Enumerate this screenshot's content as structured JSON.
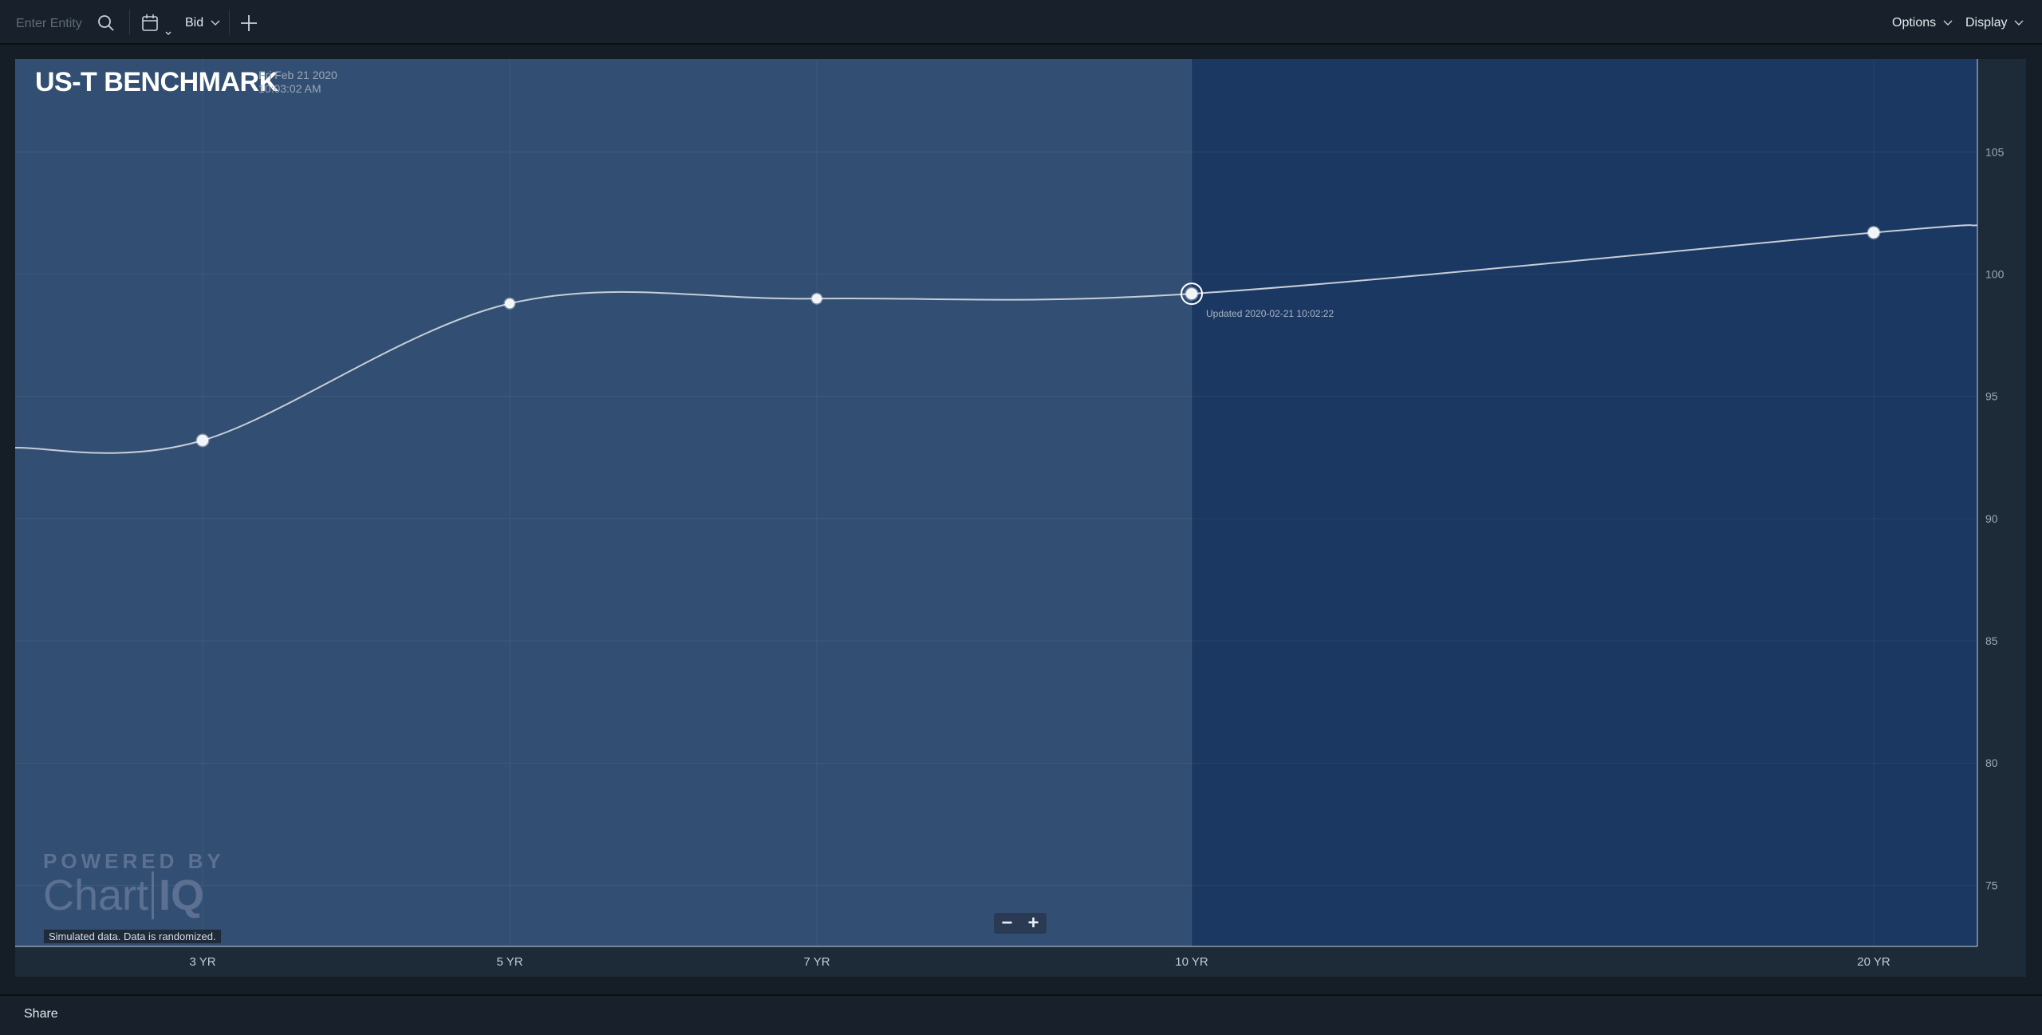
{
  "toolbar": {
    "entity_placeholder": "Enter Entity",
    "bid_label": "Bid",
    "options_label": "Options",
    "display_label": "Display"
  },
  "chart": {
    "title": "US-T BENCHMARK",
    "date": "Fri Feb 21 2020",
    "time": "10:03:02 AM",
    "updated_label": "Updated 2020-02-21 10:02:22",
    "logo_top": "POWERED BY",
    "logo_chart": "Chart",
    "logo_iq": "IQ",
    "sim_note": "Simulated data.  Data is randomized."
  },
  "footer": {
    "share_label": "Share"
  },
  "colors": {
    "shade_left": "#324f73",
    "shade_right": "#1b3862",
    "line": "#c5ced8"
  },
  "chart_data": {
    "type": "line",
    "title": "US-T BENCHMARK",
    "categories": [
      "3 YR",
      "5 YR",
      "7 YR",
      "10 YR",
      "20 YR"
    ],
    "x": [
      3,
      5,
      7,
      10,
      20
    ],
    "values": [
      93.2,
      98.8,
      99.0,
      99.2,
      101.7
    ],
    "highlight": "10 YR",
    "yticks": [
      75,
      80,
      85,
      90,
      95,
      100,
      105
    ],
    "ylim": [
      72.5,
      108.8
    ],
    "grid": true
  }
}
